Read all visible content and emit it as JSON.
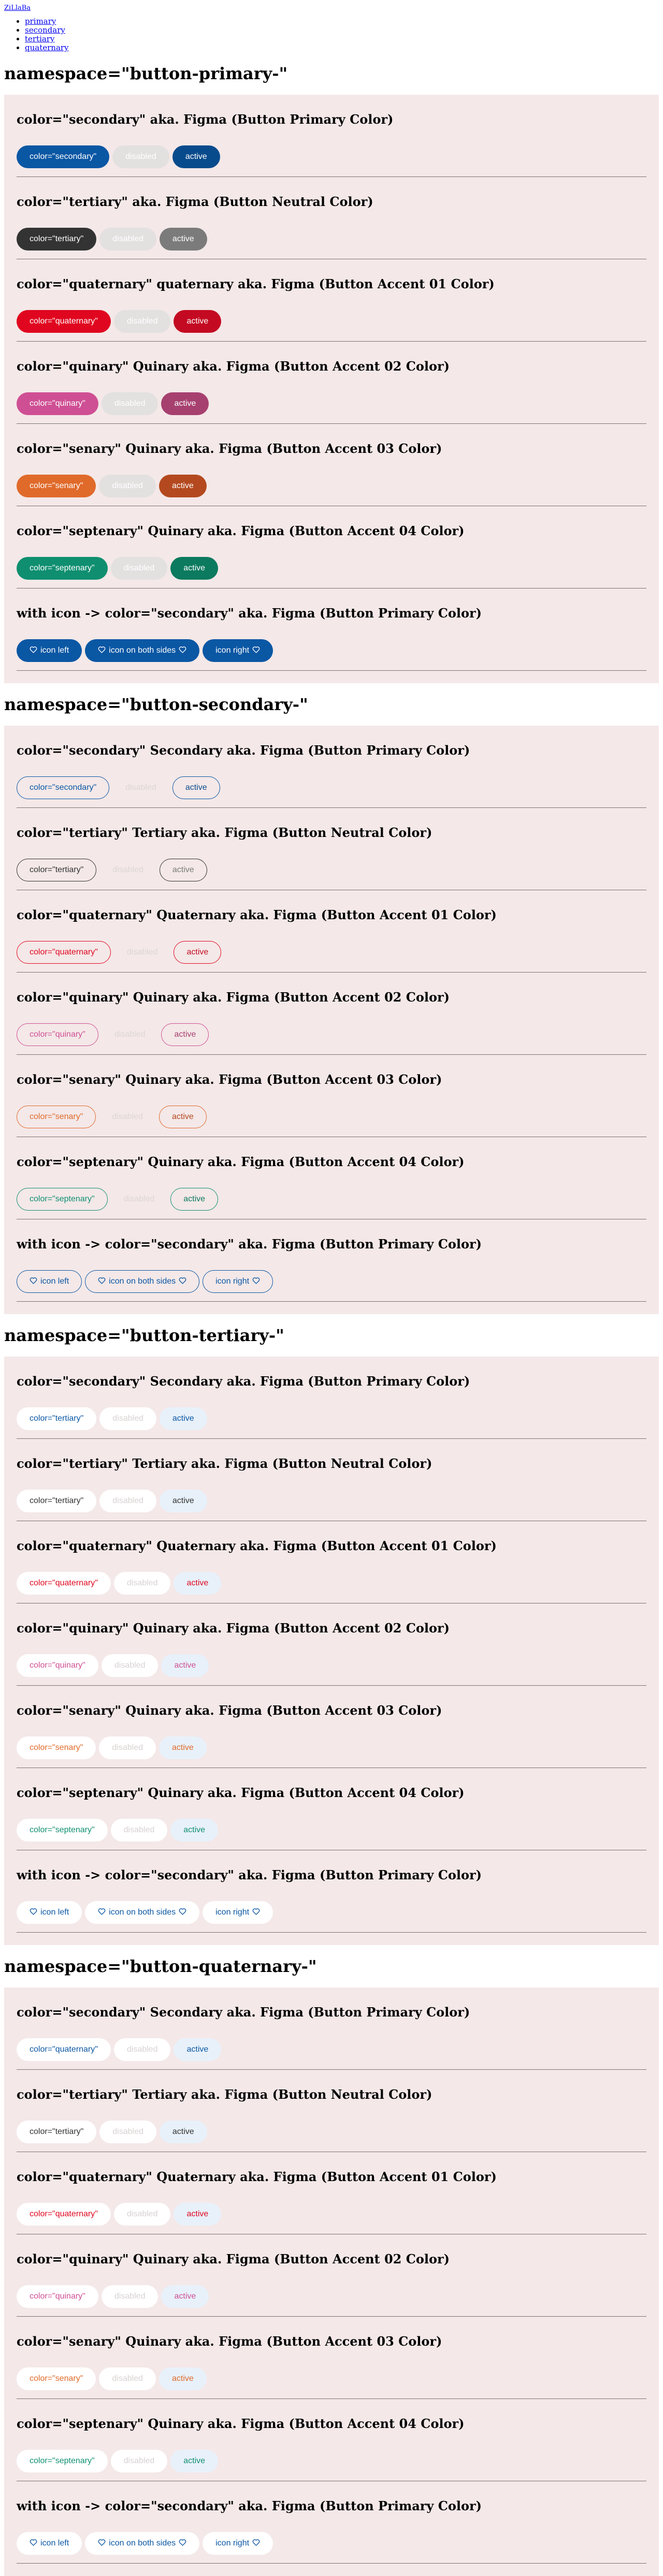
{
  "top_link": "ZiLlaBa",
  "nav": [
    "primary",
    "secondary",
    "tertiary",
    "quaternary"
  ],
  "colors": {
    "secondary": "#0a57a4",
    "secondary_active": "#084b8c",
    "tertiary": "#333333",
    "tertiary_active": "#7b7b7b",
    "quaternary": "#e0061f",
    "quaternary_active": "#c40a22",
    "quinary": "#cf4f94",
    "quinary_active": "#a6406f",
    "senary": "#e06a2a",
    "senary_active": "#b4491f",
    "septenary": "#0f8f70",
    "septenary_active": "#0b7a5e"
  },
  "icon_heart": "heart-outline-icon",
  "namespaces": [
    {
      "key": "primary",
      "title": "namespace=\"button-primary-\"",
      "sections": [
        {
          "heading": "color=\"secondary\" aka. Figma (Button Primary Color)",
          "color": "secondary",
          "buttons": [
            "color=\"secondary\"",
            "disabled",
            "active"
          ]
        },
        {
          "heading": "color=\"tertiary\" aka. Figma (Button Neutral Color)",
          "color": "tertiary",
          "buttons": [
            "color=\"tertiary\"",
            "disabled",
            "active"
          ]
        },
        {
          "heading": "color=\"quaternary\" quaternary aka. Figma (Button Accent 01 Color)",
          "color": "quaternary",
          "buttons": [
            "color=\"quaternary\"",
            "disabled",
            "active"
          ]
        },
        {
          "heading": "color=\"quinary\" Quinary aka. Figma (Button Accent 02 Color)",
          "color": "quinary",
          "buttons": [
            "color=\"quinary\"",
            "disabled",
            "active"
          ]
        },
        {
          "heading": "color=\"senary\" Quinary aka. Figma (Button Accent 03 Color)",
          "color": "senary",
          "buttons": [
            "color=\"senary\"",
            "disabled",
            "active"
          ]
        },
        {
          "heading": "color=\"septenary\" Quinary aka. Figma (Button Accent 04 Color)",
          "color": "septenary",
          "buttons": [
            "color=\"septenary\"",
            "disabled",
            "active"
          ]
        },
        {
          "heading": "with icon -> color=\"secondary\" aka. Figma (Button Primary Color)",
          "color": "secondary",
          "icons": true,
          "buttons": [
            "icon left",
            "icon on both sides",
            "icon right"
          ]
        }
      ]
    },
    {
      "key": "secondary",
      "title": "namespace=\"button-secondary-\"",
      "sections": [
        {
          "heading": "color=\"secondary\" Secondary aka. Figma (Button Primary Color)",
          "color": "secondary",
          "buttons": [
            "color=\"secondary\"",
            "disabled",
            "active"
          ]
        },
        {
          "heading": "color=\"tertiary\" Tertiary aka. Figma (Button Neutral Color)",
          "color": "tertiary",
          "buttons": [
            "color=\"tertiary\"",
            "disabled",
            "active"
          ]
        },
        {
          "heading": "color=\"quaternary\" Quaternary aka. Figma (Button Accent 01 Color)",
          "color": "quaternary",
          "buttons": [
            "color=\"quaternary\"",
            "disabled",
            "active"
          ]
        },
        {
          "heading": "color=\"quinary\" Quinary aka. Figma (Button Accent 02 Color)",
          "color": "quinary",
          "buttons": [
            "color=\"quinary\"",
            "disabled",
            "active"
          ]
        },
        {
          "heading": "color=\"senary\" Quinary aka. Figma (Button Accent 03 Color)",
          "color": "senary",
          "buttons": [
            "color=\"senary\"",
            "disabled",
            "active"
          ]
        },
        {
          "heading": "color=\"septenary\" Quinary aka. Figma (Button Accent 04 Color)",
          "color": "septenary",
          "buttons": [
            "color=\"septenary\"",
            "disabled",
            "active"
          ]
        },
        {
          "heading": "with icon -> color=\"secondary\" aka. Figma (Button Primary Color)",
          "color": "secondary",
          "icons": true,
          "buttons": [
            "icon left",
            "icon on both sides",
            "icon right"
          ]
        }
      ]
    },
    {
      "key": "tertiary",
      "title": "namespace=\"button-tertiary-\"",
      "sections": [
        {
          "heading": "color=\"secondary\" Secondary aka. Figma (Button Primary Color)",
          "color": "secondary",
          "buttons": [
            "color=\"tertiary\"",
            "disabled",
            "active"
          ]
        },
        {
          "heading": "color=\"tertiary\" Tertiary aka. Figma (Button Neutral Color)",
          "color": "tertiary",
          "buttons": [
            "color=\"tertiary\"",
            "disabled",
            "active"
          ]
        },
        {
          "heading": "color=\"quaternary\" Quaternary aka. Figma (Button Accent 01 Color)",
          "color": "quaternary",
          "buttons": [
            "color=\"quaternary\"",
            "disabled",
            "active"
          ]
        },
        {
          "heading": "color=\"quinary\" Quinary aka. Figma (Button Accent 02 Color)",
          "color": "quinary",
          "buttons": [
            "color=\"quinary\"",
            "disabled",
            "active"
          ]
        },
        {
          "heading": "color=\"senary\" Quinary aka. Figma (Button Accent 03 Color)",
          "color": "senary",
          "buttons": [
            "color=\"senary\"",
            "disabled",
            "active"
          ]
        },
        {
          "heading": "color=\"septenary\" Quinary aka. Figma (Button Accent 04 Color)",
          "color": "septenary",
          "buttons": [
            "color=\"septenary\"",
            "disabled",
            "active"
          ]
        },
        {
          "heading": "with icon -> color=\"secondary\" aka. Figma (Button Primary Color)",
          "color": "secondary",
          "icons": true,
          "buttons": [
            "icon left",
            "icon on both sides",
            "icon right"
          ]
        }
      ]
    },
    {
      "key": "quaternary",
      "title": "namespace=\"button-quaternary-\"",
      "sections": [
        {
          "heading": "color=\"secondary\" Secondary aka. Figma (Button Primary Color)",
          "color": "secondary",
          "buttons": [
            "color=\"quaternary\"",
            "disabled",
            "active"
          ]
        },
        {
          "heading": "color=\"tertiary\" Tertiary aka. Figma (Button Neutral Color)",
          "color": "tertiary",
          "buttons": [
            "color=\"tertiary\"",
            "disabled",
            "active"
          ]
        },
        {
          "heading": "color=\"quaternary\" Quaternary aka. Figma (Button Accent 01 Color)",
          "color": "quaternary",
          "buttons": [
            "color=\"quaternary\"",
            "disabled",
            "active"
          ]
        },
        {
          "heading": "color=\"quinary\" Quinary aka. Figma (Button Accent 02 Color)",
          "color": "quinary",
          "buttons": [
            "color=\"quinary\"",
            "disabled",
            "active"
          ]
        },
        {
          "heading": "color=\"senary\" Quinary aka. Figma (Button Accent 03 Color)",
          "color": "senary",
          "buttons": [
            "color=\"senary\"",
            "disabled",
            "active"
          ]
        },
        {
          "heading": "color=\"septenary\" Quinary aka. Figma (Button Accent 04 Color)",
          "color": "septenary",
          "buttons": [
            "color=\"septenary\"",
            "disabled",
            "active"
          ]
        },
        {
          "heading": "with icon -> color=\"secondary\" aka. Figma (Button Primary Color)",
          "color": "secondary",
          "icons": true,
          "buttons": [
            "icon left",
            "icon on both sides",
            "icon right"
          ]
        }
      ]
    }
  ]
}
